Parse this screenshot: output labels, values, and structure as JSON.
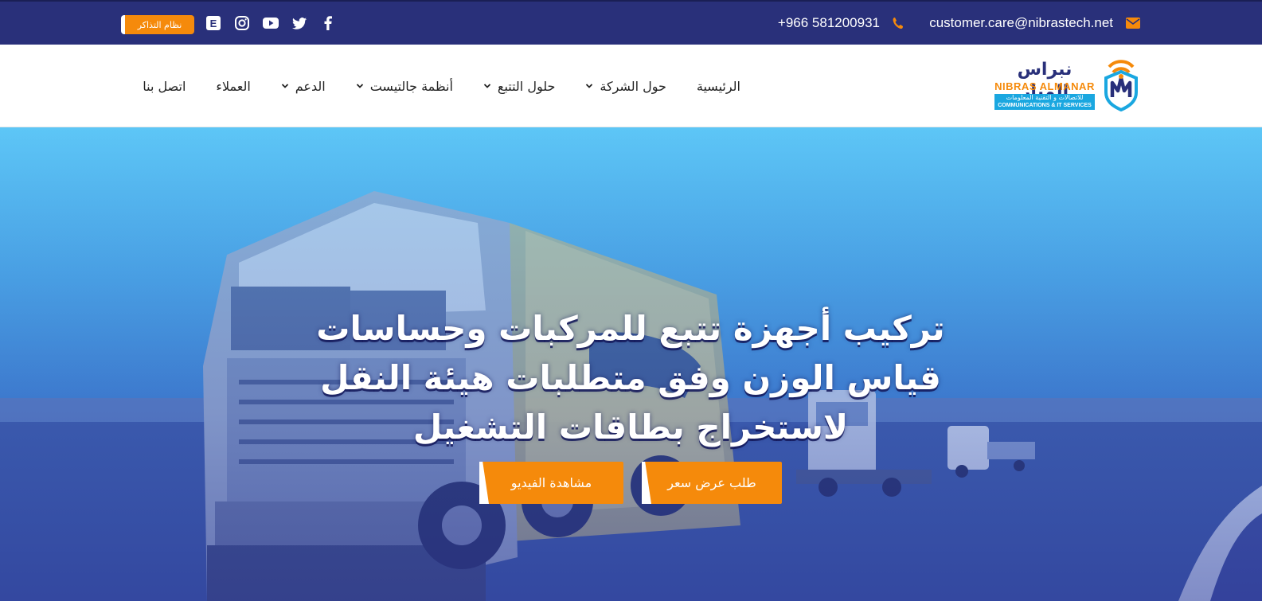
{
  "topbar": {
    "email": "customer.care@nibrastech.net",
    "email_icon": "envelope-icon",
    "phone": "+966 581200931",
    "phone_icon": "phone-icon",
    "ticket_label": "نظام التذاكر",
    "socials": [
      "facebook-icon",
      "twitter-icon",
      "youtube-icon",
      "instagram-icon",
      "etimad-icon"
    ],
    "colors": {
      "bar": "#29307a",
      "accent": "#f58a0b"
    }
  },
  "logo": {
    "arabic": "نبراس المنار",
    "english": "NIBRAS ALMANAR",
    "tagline_ar": "للاتصالات و التقنية المعلومات",
    "tagline_en": "COMMUNICATIONS & IT SERVICES"
  },
  "nav": {
    "items": [
      {
        "label": "الرئيسية",
        "dropdown": false
      },
      {
        "label": "حول الشركة",
        "dropdown": true
      },
      {
        "label": "حلول التتبع",
        "dropdown": true
      },
      {
        "label": "أنظمة جالتيست",
        "dropdown": true
      },
      {
        "label": "الدعم",
        "dropdown": true
      },
      {
        "label": "العملاء",
        "dropdown": false
      },
      {
        "label": "اتصل بنا",
        "dropdown": false
      }
    ]
  },
  "hero": {
    "title_lines": [
      "تركيب أجهزة تتبع للمركبات وحساسات",
      "قياس الوزن وفق متطلبات هيئة النقل",
      "لاستخراج بطاقات التشغيل"
    ],
    "buttons": {
      "quote": "طلب عرض سعر",
      "video": "مشاهدة الفيديو"
    },
    "background_image": "truck-fleet-photo"
  }
}
